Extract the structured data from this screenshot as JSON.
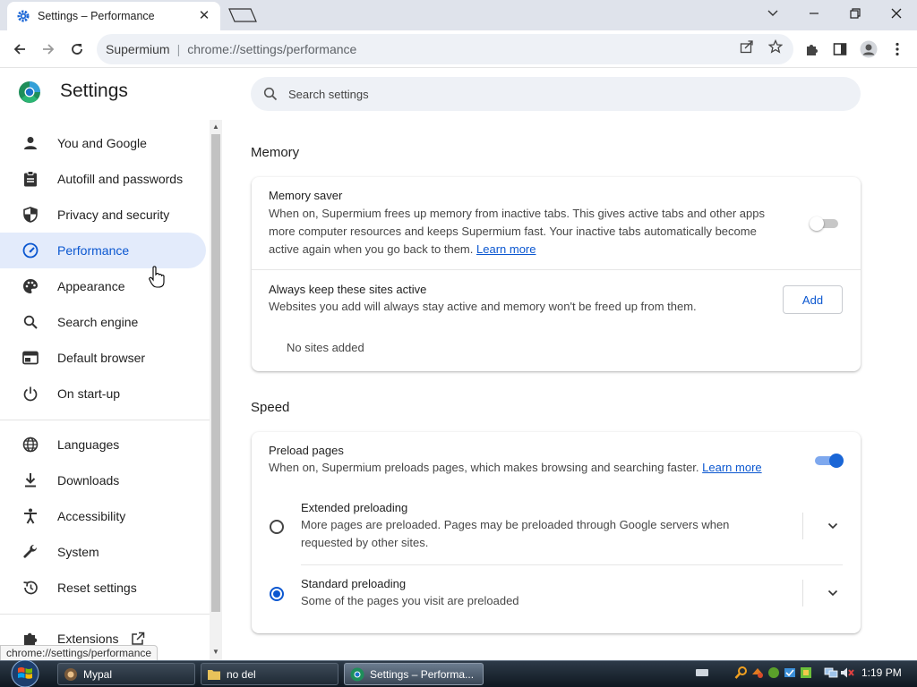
{
  "browser": {
    "tab_title": "Settings – Performance",
    "omnibox_site": "Supermium",
    "omnibox_url": "chrome://settings/performance"
  },
  "settings": {
    "title": "Settings",
    "search_placeholder": "Search settings"
  },
  "sidebar": {
    "items": [
      {
        "label": "You and Google",
        "icon": "person-icon"
      },
      {
        "label": "Autofill and passwords",
        "icon": "clipboard-icon"
      },
      {
        "label": "Privacy and security",
        "icon": "shield-icon"
      },
      {
        "label": "Performance",
        "icon": "speedometer-icon",
        "active": true
      },
      {
        "label": "Appearance",
        "icon": "palette-icon"
      },
      {
        "label": "Search engine",
        "icon": "search-icon"
      },
      {
        "label": "Default browser",
        "icon": "browser-icon"
      },
      {
        "label": "On start-up",
        "icon": "power-icon"
      },
      {
        "label": "Languages",
        "icon": "globe-icon"
      },
      {
        "label": "Downloads",
        "icon": "download-icon"
      },
      {
        "label": "Accessibility",
        "icon": "accessibility-icon"
      },
      {
        "label": "System",
        "icon": "wrench-icon"
      },
      {
        "label": "Reset settings",
        "icon": "reset-icon"
      },
      {
        "label": "Extensions",
        "icon": "puzzle-icon"
      }
    ]
  },
  "memory": {
    "section_title": "Memory",
    "saver_title": "Memory saver",
    "saver_desc_line1": "When on, Supermium frees up memory from inactive tabs. This gives active tabs and other apps",
    "saver_desc_line2": "more computer resources and keeps Supermium fast. Your inactive tabs automatically become",
    "saver_desc_line3": "active again when you go back to them.",
    "saver_learn_more": "Learn more",
    "saver_enabled": false,
    "keep_active_title": "Always keep these sites active",
    "keep_active_desc": "Websites you add will always stay active and memory won't be freed up from them.",
    "add_label": "Add",
    "no_sites": "No sites added"
  },
  "speed": {
    "section_title": "Speed",
    "preload_title": "Preload pages",
    "preload_desc": "When on, Supermium preloads pages, which makes browsing and searching faster.",
    "preload_learn_more": "Learn more",
    "preload_enabled": true,
    "extended_title": "Extended preloading",
    "extended_desc_line1": "More pages are preloaded. Pages may be preloaded through Google servers when",
    "extended_desc_line2": "requested by other sites.",
    "standard_title": "Standard preloading",
    "standard_desc": "Some of the pages you visit are preloaded",
    "selected": "standard"
  },
  "status_url": "chrome://settings/performance",
  "taskbar": {
    "items": [
      {
        "label": "Mypal"
      },
      {
        "label": "no del"
      },
      {
        "label": "Settings – Performa..."
      }
    ],
    "clock": "1:19 PM"
  },
  "colors": {
    "accent": "#0b57d0",
    "active_nav_bg": "#e3ebfb",
    "toggle_on": "#1a66d6"
  }
}
